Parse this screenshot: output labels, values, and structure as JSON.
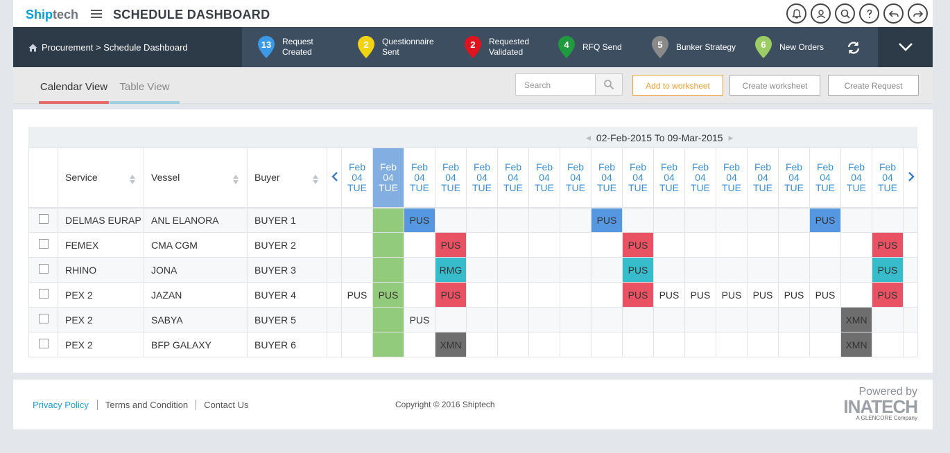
{
  "app": {
    "logo_main": "Ship",
    "logo_sub": "tech",
    "title": "SCHEDULE DASHBOARD"
  },
  "top_icons": [
    "bell-icon",
    "user-icon",
    "search-icon",
    "help-icon",
    "undo-icon",
    "redo-icon"
  ],
  "breadcrumb": "Procurement > Schedule Dashboard",
  "stats": [
    {
      "count": "13",
      "label1": "Request",
      "label2": "Created",
      "color": "#3a9ae8"
    },
    {
      "count": "2",
      "label1": "Questionnaire",
      "label2": "Sent",
      "color": "#f2d314"
    },
    {
      "count": "2",
      "label1": "Requested",
      "label2": "Validated",
      "color": "#e0141e"
    },
    {
      "count": "4",
      "label1": "RFQ Send",
      "label2": "",
      "color": "#1f9a3e"
    },
    {
      "count": "5",
      "label1": "Bunker Strategy",
      "label2": "",
      "color": "#8a8a8a"
    },
    {
      "count": "6",
      "label1": "New Orders",
      "label2": "",
      "color": "#9ccc65"
    }
  ],
  "tabs": {
    "calendar": "Calendar View",
    "table": "Table View"
  },
  "search": {
    "placeholder": "Search"
  },
  "buttons": {
    "add_worksheet": "Add to worksheet",
    "create_worksheet": "Create worksheet",
    "create_request": "Create Request"
  },
  "date_range": "02-Feb-2015 To 09-Mar-2015",
  "columns": {
    "service": "Service",
    "vessel": "Vessel",
    "buyer": "Buyer"
  },
  "day_header": {
    "month": "Feb",
    "day": "04",
    "weekday": "TUE"
  },
  "rows": [
    {
      "service": "DELMAS EURAP",
      "vessel": "ANL ELANORA",
      "buyer": "BUYER 1",
      "cells": [
        "",
        "",
        "PUS",
        "",
        "",
        "",
        "",
        "",
        "PUS",
        "",
        "",
        "",
        "",
        "",
        "",
        "PUS",
        "",
        ""
      ]
    },
    {
      "service": "FEMEX",
      "vessel": "CMA CGM",
      "buyer": "BUYER 2",
      "cells": [
        "",
        "",
        "",
        "PUS",
        "",
        "",
        "",
        "",
        "",
        "PUS",
        "",
        "",
        "",
        "",
        "",
        "",
        "",
        "PUS"
      ]
    },
    {
      "service": "RHINO",
      "vessel": "JONA",
      "buyer": "BUYER 3",
      "cells": [
        "",
        "",
        "",
        "RMG",
        "",
        "",
        "",
        "",
        "",
        "PUS",
        "",
        "",
        "",
        "",
        "",
        "",
        "",
        "PUS"
      ]
    },
    {
      "service": "PEX 2",
      "vessel": "JAZAN",
      "buyer": "BUYER 4",
      "cells": [
        "PUS",
        "PUS",
        "",
        "PUS",
        "",
        "",
        "",
        "",
        "",
        "PUS",
        "PUS",
        "PUS",
        "PUS",
        "PUS",
        "PUS",
        "PUS",
        "",
        "PUS"
      ]
    },
    {
      "service": "PEX 2",
      "vessel": "SABYA",
      "buyer": "BUYER 5",
      "cells": [
        "",
        "",
        "PUS",
        "",
        "",
        "",
        "",
        "",
        "",
        "",
        "",
        "",
        "",
        "",
        "",
        "",
        "XMN",
        ""
      ]
    },
    {
      "service": "PEX 2",
      "vessel": "BFP GALAXY",
      "buyer": "BUYER 6",
      "cells": [
        "",
        "",
        "",
        "XMN",
        "",
        "",
        "",
        "",
        "",
        "",
        "",
        "",
        "",
        "",
        "",
        "",
        "XMN",
        ""
      ]
    }
  ],
  "cell_styles": [
    [
      "",
      "",
      "blue",
      "",
      "",
      "",
      "",
      "",
      "blue",
      "",
      "",
      "",
      "",
      "",
      "",
      "blue",
      "",
      ""
    ],
    [
      "",
      "",
      "",
      "red",
      "",
      "",
      "",
      "",
      "",
      "red",
      "",
      "",
      "",
      "",
      "",
      "",
      "",
      "red"
    ],
    [
      "",
      "",
      "",
      "teal",
      "",
      "",
      "",
      "",
      "",
      "teal",
      "",
      "",
      "",
      "",
      "",
      "",
      "",
      "teal"
    ],
    [
      "plain",
      "plain",
      "",
      "red",
      "",
      "",
      "",
      "",
      "",
      "red",
      "plain",
      "plain",
      "plain",
      "plain",
      "plain",
      "plain",
      "",
      "red"
    ],
    [
      "",
      "",
      "plain",
      "",
      "",
      "",
      "",
      "",
      "",
      "",
      "",
      "",
      "",
      "",
      "",
      "",
      "gray",
      ""
    ],
    [
      "",
      "",
      "",
      "gray",
      "",
      "",
      "",
      "",
      "",
      "",
      "",
      "",
      "",
      "",
      "",
      "",
      "gray",
      ""
    ]
  ],
  "active_day_index": 1,
  "footer": {
    "privacy": "Privacy Policy",
    "terms": "Terms and Condition",
    "contact": "Contact Us",
    "copyright": "Copyright © 2016 Shiptech",
    "powered_by": "Powered by",
    "brand": "INATECH",
    "brand_sub": "A GLENCORE Company"
  }
}
